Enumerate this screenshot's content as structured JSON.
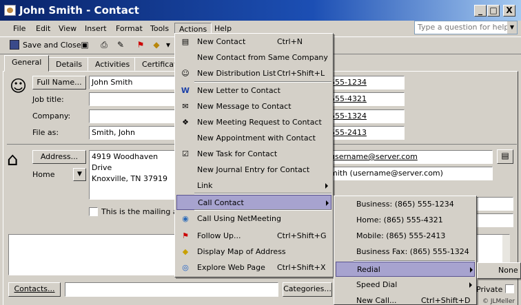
{
  "window": {
    "title": "John Smith - Contact",
    "minimize": "_",
    "maximize": "□",
    "close": "X"
  },
  "menubar": {
    "items": [
      "File",
      "Edit",
      "View",
      "Insert",
      "Format",
      "Tools",
      "Actions",
      "Help"
    ],
    "active": "Actions"
  },
  "help_box": {
    "placeholder": "Type a question for help"
  },
  "toolbar": {
    "save_close_label": "Save and Close"
  },
  "tabs": [
    "General",
    "Details",
    "Activities",
    "Certificates"
  ],
  "form": {
    "full_name_button": "Full Name...",
    "full_name": "John Smith",
    "job_title_label": "Job title:",
    "job_title": "",
    "company_label": "Company:",
    "company": "",
    "file_as_label": "File as:",
    "file_as": "Smith, John",
    "phones": [
      "555-1234",
      "555-4321",
      "555-1324",
      "555-2413"
    ],
    "address_button": "Address...",
    "address_type": "Home",
    "address_lines": [
      "4919 Woodhaven Drive",
      "Knoxville, TN  37919"
    ],
    "email": "username@server.com",
    "display_as": "mith (username@server.com)",
    "mailing_address_label": "This is the mailing addr",
    "contacts_button": "Contacts...",
    "categories_button": "Categories...",
    "private_label": "Private",
    "watermark": "© JLMeller"
  },
  "actions_menu": [
    {
      "label": "New Contact",
      "shortcut": "Ctrl+N",
      "icon": "contact-card-icon"
    },
    {
      "label": "New Contact from Same Company",
      "shortcut": "",
      "icon": ""
    },
    {
      "label": "New Distribution List",
      "shortcut": "Ctrl+Shift+L",
      "icon": "distribution-list-icon"
    },
    {
      "label": "New Letter to Contact",
      "shortcut": "",
      "icon": "word-icon"
    },
    {
      "label": "New Message to Contact",
      "shortcut": "",
      "icon": "message-icon"
    },
    {
      "label": "New Meeting Request to Contact",
      "shortcut": "",
      "icon": "meeting-icon"
    },
    {
      "label": "New Appointment with Contact",
      "shortcut": "",
      "icon": ""
    },
    {
      "label": "New Task for Contact",
      "shortcut": "",
      "icon": "task-icon"
    },
    {
      "label": "New Journal Entry for Contact",
      "shortcut": "",
      "icon": ""
    },
    {
      "label": "Link",
      "shortcut": "",
      "icon": ""
    },
    {
      "label": "Call Contact",
      "shortcut": "",
      "icon": ""
    },
    {
      "label": "Call Using NetMeeting",
      "shortcut": "",
      "icon": "netmeeting-icon"
    },
    {
      "label": "Follow Up...",
      "shortcut": "Ctrl+Shift+G",
      "icon": "flag-icon"
    },
    {
      "label": "Display Map of Address",
      "shortcut": "",
      "icon": "map-icon"
    },
    {
      "label": "Explore Web Page",
      "shortcut": "Ctrl+Shift+X",
      "icon": "web-page-icon"
    }
  ],
  "call_submenu": [
    {
      "label": "Business: (865) 555-1234",
      "shortcut": ""
    },
    {
      "label": "Home: (865) 555-4321",
      "shortcut": ""
    },
    {
      "label": "Mobile: (865) 555-2413",
      "shortcut": ""
    },
    {
      "label": "Business Fax: (865) 555-1324",
      "shortcut": ""
    },
    {
      "label": "Redial",
      "shortcut": ""
    },
    {
      "label": "Speed Dial",
      "shortcut": ""
    },
    {
      "label": "New Call...",
      "shortcut": "Ctrl+Shift+D"
    }
  ],
  "redial_submenu": {
    "label": "None"
  },
  "colors": {
    "titlebar": "#0a246a",
    "highlight": "#a7a3cf",
    "face": "#d4d0c8"
  }
}
